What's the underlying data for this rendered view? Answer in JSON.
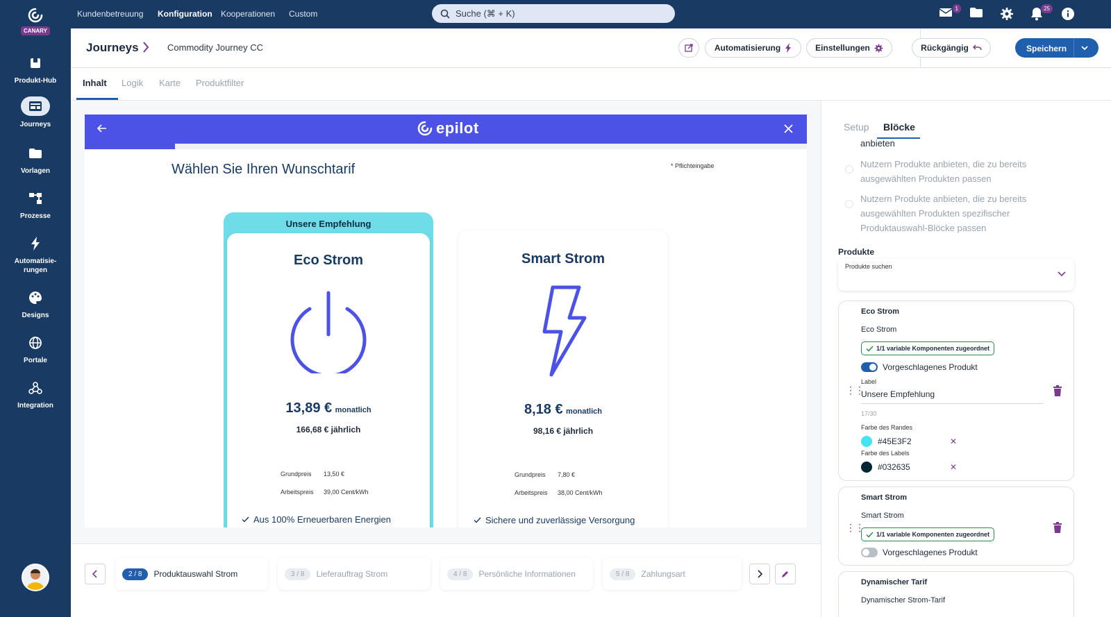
{
  "brand": {
    "badge": "CANARY"
  },
  "sidenav": {
    "items": [
      {
        "label": "Produkt-Hub",
        "icon": "box-icon"
      },
      {
        "label": "Journeys",
        "icon": "journeys-icon"
      },
      {
        "label": "Vorlagen",
        "icon": "folder-icon"
      },
      {
        "label": "Prozesse",
        "icon": "process-icon"
      },
      {
        "label": "Automatisie-",
        "label2": "rungen",
        "icon": "lightning-icon"
      },
      {
        "label": "Designs",
        "icon": "palette-icon"
      },
      {
        "label": "Portale",
        "icon": "globe-icon"
      },
      {
        "label": "Integration",
        "icon": "webhook-icon"
      }
    ]
  },
  "topbar": {
    "menu": [
      "Kundenbetreuung",
      "Konfiguration",
      "Kooperationen",
      "Custom"
    ],
    "search_placeholder": "Suche (⌘ + K)",
    "mail_count": "1",
    "notif_count": "25"
  },
  "header": {
    "title": "Journeys",
    "journey_name": "Commodity Journey CC",
    "automation": "Automatisierung",
    "settings": "Einstellungen",
    "undo": "Rückgängig",
    "save": "Speichern"
  },
  "tabs": [
    "Inhalt",
    "Logik",
    "Karte",
    "Produktfilter"
  ],
  "preview": {
    "brand": "epilot",
    "progress": 0.125,
    "title": "Wählen Sie Ihren Wunschtarif",
    "required": "* Pflichteingabe",
    "products": [
      {
        "recommend": "Unsere Empfehlung",
        "name": "Eco Strom",
        "price": "13,89 €",
        "period": "monatlich",
        "yearly": "166,68 € jährlich",
        "base_label": "Grundpreis",
        "base_value": "13,50 €",
        "work_label": "Arbeitspreis",
        "work_value": "39,00 Cent/kWh",
        "feature": "Aus 100% Erneuerbaren Energien"
      },
      {
        "name": "Smart Strom",
        "price": "8,18 €",
        "period": "monatlich",
        "yearly": "98,16 € jährlich",
        "base_label": "Grundpreis",
        "base_value": "7,80 €",
        "work_label": "Arbeitspreis",
        "work_value": "38,00 Cent/kWh",
        "feature": "Sichere und zuverlässige Versorgung"
      }
    ]
  },
  "steps": [
    {
      "num": "2 / 8",
      "label": "Produktauswahl Strom"
    },
    {
      "num": "3 / 8",
      "label": "Lieferauftrag Strom"
    },
    {
      "num": "4 / 8",
      "label": "Persönliche Informationen"
    },
    {
      "num": "5 / 8",
      "label": "Zahlungsart"
    }
  ],
  "panel": {
    "tabs": [
      "Setup",
      "Blöcke"
    ],
    "options": [
      "anbieten",
      "Nutzern Produkte anbieten, die zu bereits",
      "ausgewählten Produkten passen",
      "Nutzern Produkte anbieten, die zu bereits",
      "ausgewählten Produkten spezifischer",
      "Produktauswahl-Blöcke passen"
    ],
    "products_label": "Produkte",
    "products_search": "Produkte suchen",
    "cards": [
      {
        "title": "Eco Strom",
        "subtitle": "Eco Strom",
        "chip": "1/1 variable Komponenten zugeordnet",
        "suggest_label": "Vorgeschlagenes Produkt",
        "suggest_on": true,
        "label_caption": "Label",
        "label_value": "Unsere Empfehlung",
        "counter": "17/30",
        "border_caption": "Farbe des Randes",
        "border_color": "#45E3F2",
        "label_color_caption": "Farbe des Labels",
        "label_color": "#032635"
      },
      {
        "title": "Smart Strom",
        "subtitle": "Smart Strom",
        "chip": "1/1 variable Komponenten zugeordnet",
        "suggest_label": "Vorgeschlagenes Produkt",
        "suggest_on": false
      },
      {
        "title": "Dynamischer Tarif",
        "subtitle": "Dynamischer Strom-Tarif"
      }
    ]
  },
  "colors": {
    "nav": "#183a63",
    "accent": "#1f5fae",
    "preview": "#4c52e6",
    "highlight": "#6fdde8",
    "purple": "#7a3a8f"
  }
}
